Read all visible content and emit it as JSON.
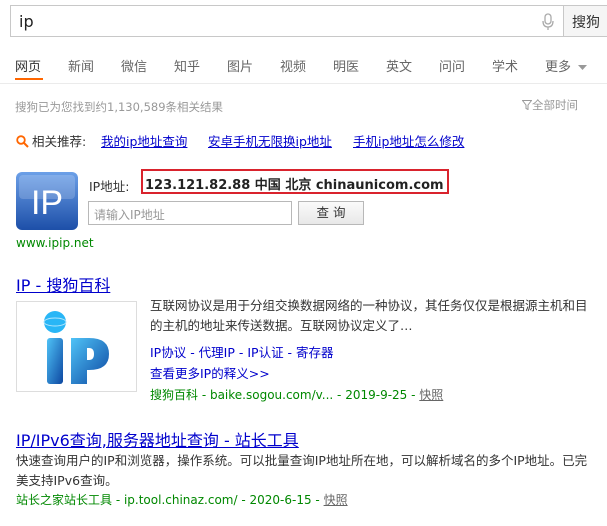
{
  "search": {
    "query": "ip",
    "button_label": "搜狗"
  },
  "tabs": [
    "网页",
    "新闻",
    "微信",
    "知乎",
    "图片",
    "视频",
    "明医",
    "英文",
    "问问",
    "学术",
    "更多"
  ],
  "stats_text": "搜狗已为您找到约1,130,589条相关结果",
  "filter_label": "全部时间",
  "related": {
    "label": "相关推荐:",
    "links": [
      "我的ip地址查询",
      "安卓手机无限换ip地址",
      "手机ip地址怎么修改"
    ]
  },
  "ip_widget": {
    "label": "IP地址:",
    "value": "123.121.82.88   中国 北京 chinaunicom.com",
    "input_placeholder": "请输入IP地址",
    "query_button": "查 询",
    "site": "www.ipip.net",
    "logo_text": "IP"
  },
  "result1": {
    "title": "IP - 搜狗百科",
    "desc": "互联网协议是用于分组交换数据网络的一种协议，其任务仅仅是根据源主机和目的主机的地址来传送数据。互联网协议定义了…",
    "tags": "IP协议 - 代理IP - IP认证 - 寄存器",
    "more": "查看更多IP的释义>>",
    "source": "搜狗百科 - baike.sogou.com/v... - 2019-9-25 - ",
    "snapshot": "快照"
  },
  "result2": {
    "title": "IP/IPv6查询,服务器地址查询 - 站长工具",
    "desc": "快速查询用户的IP和浏览器，操作系统。可以批量查询IP地址所在地，可以解析域名的多个IP地址。已完美支持IPv6查询。",
    "source": "站长之家站长工具 - ip.tool.chinaz.com/ - 2020-6-15 - ",
    "snapshot": "快照"
  },
  "colors": {
    "accent": "#ff6600",
    "link": "#0000cc",
    "url_green": "#008000",
    "highlight_border": "#d9232d"
  }
}
